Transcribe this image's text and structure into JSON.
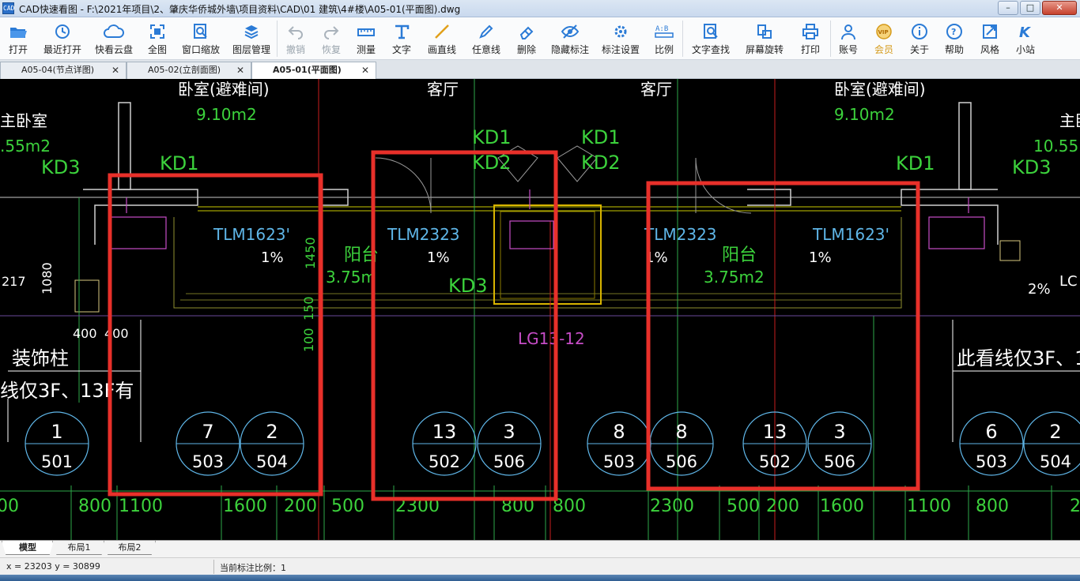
{
  "app": {
    "icon_text": "CAD",
    "title": "CAD快速看图 - F:\\2021年项目\\2、肇庆华侨城外墙\\项目资料\\CAD\\01 建筑\\4#楼\\A05-01(平面图).dwg",
    "window_buttons": [
      "minimize",
      "maximize",
      "close"
    ]
  },
  "toolbar": [
    {
      "label": "打开",
      "icon": "open-folder-icon",
      "enabled": true
    },
    {
      "label": "最近打开",
      "icon": "recent-clock-icon",
      "enabled": true
    },
    {
      "label": "快看云盘",
      "icon": "cloud-icon",
      "enabled": true
    },
    {
      "label": "全图",
      "icon": "fullview-icon",
      "enabled": true
    },
    {
      "label": "窗口缩放",
      "icon": "zoom-window-icon",
      "enabled": true
    },
    {
      "label": "图层管理",
      "icon": "layers-icon",
      "enabled": true
    },
    {
      "label": "撤销",
      "icon": "undo-icon",
      "enabled": false
    },
    {
      "label": "恢复",
      "icon": "redo-icon",
      "enabled": false
    },
    {
      "label": "测量",
      "icon": "measure-icon",
      "enabled": true
    },
    {
      "label": "文字",
      "icon": "text-icon",
      "enabled": true
    },
    {
      "label": "画直线",
      "icon": "line-icon",
      "enabled": true
    },
    {
      "label": "任意线",
      "icon": "freehand-icon",
      "enabled": true
    },
    {
      "label": "删除",
      "icon": "eraser-icon",
      "enabled": true
    },
    {
      "label": "隐藏标注",
      "icon": "eye-hide-icon",
      "enabled": true
    },
    {
      "label": "标注设置",
      "icon": "dimension-settings-icon",
      "enabled": true
    },
    {
      "label": "比例",
      "icon": "scale-icon",
      "enabled": true
    },
    {
      "label": "文字查找",
      "icon": "text-search-icon",
      "enabled": true
    },
    {
      "label": "屏幕旋转",
      "icon": "rotate-screen-icon",
      "enabled": true
    },
    {
      "label": "打印",
      "icon": "printer-icon",
      "enabled": true
    },
    {
      "label": "账号",
      "icon": "user-icon",
      "enabled": true
    },
    {
      "label": "会员",
      "icon": "vip-icon",
      "enabled": true
    },
    {
      "label": "关于",
      "icon": "info-icon",
      "enabled": true
    },
    {
      "label": "帮助",
      "icon": "help-icon",
      "enabled": true
    },
    {
      "label": "风格",
      "icon": "style-icon",
      "enabled": true
    },
    {
      "label": "小站",
      "icon": "kstation-icon",
      "enabled": true
    }
  ],
  "doc_tabs": [
    {
      "label": "A05-04(节点详图)",
      "active": false
    },
    {
      "label": "A05-02(立剖面图)",
      "active": false
    },
    {
      "label": "A05-01(平面图)",
      "active": true
    }
  ],
  "drawing": {
    "rooms": [
      "卧室(避难间)",
      "客厅",
      "客厅",
      "卧室(避难间)",
      "主卧室",
      "主卧"
    ],
    "areas": [
      "9.10m2",
      "9.10m2",
      ".55m2",
      "10.55m",
      "3.75m",
      "3.75m2"
    ],
    "door_tags": [
      "KD3",
      "KD1",
      "KD1",
      "KD2",
      "KD1",
      "KD2",
      "KD1",
      "KD3",
      "KD3"
    ],
    "window_tags": [
      "TLM1623'",
      "TLM2323",
      "TLM2323",
      "TLM1623'"
    ],
    "balcony_labels": [
      "阳台",
      "阳台"
    ],
    "slopes": [
      "1%",
      "1%",
      "1%",
      "1%",
      "2%"
    ],
    "railing_tag": "LG13-12",
    "lc_tag": "LC",
    "left_dims": [
      "217",
      "1080",
      "400",
      "400",
      "1450",
      "150",
      "100"
    ],
    "notes": [
      "装饰柱",
      "线仅3F、13F有",
      "此看线仅3F、13F有"
    ],
    "bubbles": [
      {
        "top": "1",
        "bottom": "501"
      },
      {
        "top": "7",
        "bottom": "503"
      },
      {
        "top": "2",
        "bottom": "504"
      },
      {
        "top": "13",
        "bottom": "502"
      },
      {
        "top": "3",
        "bottom": "506"
      },
      {
        "top": "8",
        "bottom": "503"
      },
      {
        "top": "8",
        "bottom": "506"
      },
      {
        "top": "13",
        "bottom": "502"
      },
      {
        "top": "3",
        "bottom": "506"
      },
      {
        "top": "6",
        "bottom": "503"
      },
      {
        "top": "2",
        "bottom": "504"
      }
    ],
    "bottom_dims": [
      "00",
      "800",
      "1100",
      "1600",
      "200",
      "500",
      "2300",
      "800",
      "800",
      "2300",
      "500",
      "200",
      "1600",
      "1100",
      "800",
      "2"
    ],
    "highlight_color": "#e8302a"
  },
  "layout_tabs": [
    {
      "label": "模型",
      "active": true
    },
    {
      "label": "布局1",
      "active": false
    },
    {
      "label": "布局2",
      "active": false
    }
  ],
  "status": {
    "coords": "x = 23203  y = 30899",
    "scale": "当前标注比例：1"
  }
}
